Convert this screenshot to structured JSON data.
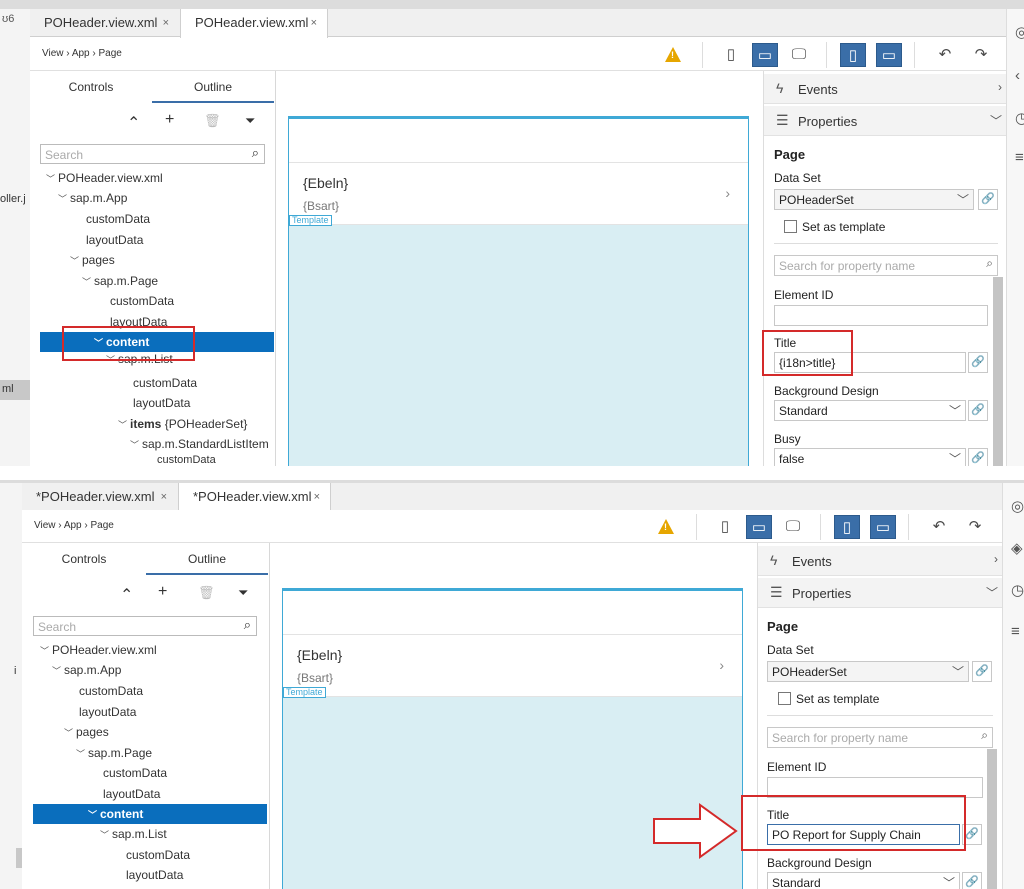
{
  "panels": [
    {
      "tabs": [
        {
          "label": "POHeader.view.xml",
          "close": "×"
        },
        {
          "label": "POHeader.view.xml",
          "close": "×"
        }
      ],
      "left_strip": {
        "text_1": "oller.j",
        "text_2": "ml",
        "top_glyph": "ʊ6"
      },
      "breadcrumb": "View › App › Page",
      "outline_tabs": [
        "Controls",
        "Outline"
      ],
      "tree_tools": [
        "⌃",
        "+",
        "🗑",
        "⏷"
      ],
      "search_placeholder": "Search",
      "tree": [
        {
          "label": "POHeader.view.xml"
        },
        {
          "label": "sap.m.App"
        },
        {
          "label": "customData"
        },
        {
          "label": "layoutData"
        },
        {
          "label": "pages"
        },
        {
          "label": "sap.m.Page"
        },
        {
          "label": "customData"
        },
        {
          "label": "layoutData"
        },
        {
          "label": "content"
        },
        {
          "label": "sap.m.List"
        },
        {
          "label": "customData"
        },
        {
          "label": "layoutData"
        },
        {
          "label": "items",
          "suffix": " {POHeaderSet}"
        },
        {
          "label": "sap.m.StandardListItem"
        },
        {
          "label": "customData"
        }
      ],
      "canvas": {
        "title": "{Ebeln}",
        "desc": "{Bsart}",
        "template": "Template"
      },
      "props": {
        "events": "Events",
        "properties": "Properties",
        "page": "Page",
        "dataset_label": "Data Set",
        "dataset_value": "POHeaderSet",
        "set_template": "Set as template",
        "search_placeholder": "Search for property name",
        "element_id": "Element ID",
        "title_label": "Title",
        "title_value": "{i18n>title}",
        "bg_label": "Background Design",
        "bg_value": "Standard",
        "busy_label": "Busy",
        "busy_value": "false"
      }
    },
    {
      "tabs": [
        {
          "label": "*POHeader.view.xml",
          "close": "×"
        },
        {
          "label": "*POHeader.view.xml",
          "close": "×"
        }
      ],
      "left_strip": {
        "text_1": "i"
      },
      "breadcrumb": "View › App › Page",
      "outline_tabs": [
        "Controls",
        "Outline"
      ],
      "tree_tools": [
        "⌃",
        "+",
        "🗑",
        "⏷"
      ],
      "search_placeholder": "Search",
      "tree": [
        {
          "label": "POHeader.view.xml"
        },
        {
          "label": "sap.m.App"
        },
        {
          "label": "customData"
        },
        {
          "label": "layoutData"
        },
        {
          "label": "pages"
        },
        {
          "label": "sap.m.Page"
        },
        {
          "label": "customData"
        },
        {
          "label": "layoutData"
        },
        {
          "label": "content"
        },
        {
          "label": "sap.m.List"
        },
        {
          "label": "customData"
        },
        {
          "label": "layoutData"
        }
      ],
      "canvas": {
        "title": "{Ebeln}",
        "desc": "{Bsart}",
        "template": "Template"
      },
      "props": {
        "events": "Events",
        "properties": "Properties",
        "page": "Page",
        "dataset_label": "Data Set",
        "dataset_value": "POHeaderSet",
        "set_template": "Set as template",
        "search_placeholder": "Search for property name",
        "element_id": "Element ID",
        "title_label": "Title",
        "title_value": "PO Report for Supply Chain",
        "bg_label": "Background Design",
        "bg_value": "Standard"
      }
    }
  ],
  "colors": {
    "selected": "#0a6ebd",
    "highlight_box": "#d42a2a",
    "canvas_frame": "#3fa9d6",
    "toolbar_selected": "#3a6ea8"
  },
  "icons": {
    "warning": "warning-icon",
    "phone": "phone-icon",
    "tablet": "tablet-icon",
    "desktop": "desktop-icon",
    "undo": "undo-icon",
    "redo": "redo-icon"
  }
}
